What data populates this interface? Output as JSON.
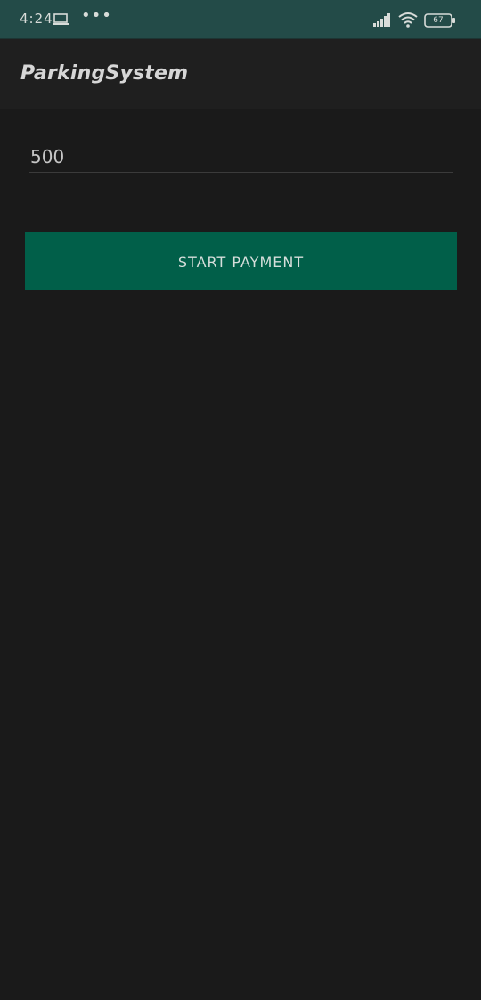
{
  "status_bar": {
    "time": "4:24",
    "more": "•••",
    "battery_level": "67",
    "icons": [
      "laptop-icon",
      "signal-icon",
      "wifi-icon",
      "battery-icon"
    ]
  },
  "app_bar": {
    "title": "ParkingSystem"
  },
  "form": {
    "amount_value": "500",
    "start_button_label": "START PAYMENT"
  },
  "colors": {
    "status_bar_bg": "#234b48",
    "background": "#1a1a1a",
    "app_bar_bg": "#1f1f1f",
    "button_bg": "#015f49"
  }
}
